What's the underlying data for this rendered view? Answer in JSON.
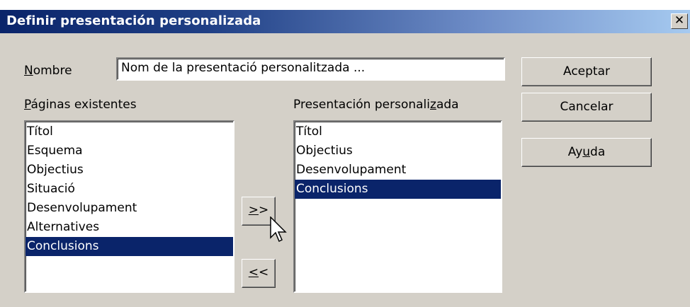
{
  "dialog": {
    "title": "Definir presentación personalizada",
    "close_glyph": "✕"
  },
  "name_field": {
    "label_mnemonic": "N",
    "label_rest": "ombre",
    "value": "Nom de la presentació personalitzada ..."
  },
  "existing_pages": {
    "label_mnemonic": "P",
    "label_rest": "áginas existentes",
    "items": [
      "Títol",
      "Esquema",
      "Objectius",
      "Situació",
      "Desenvolupament",
      "Alternatives",
      "Conclusions"
    ],
    "selected": "Conclusions"
  },
  "custom_presentation": {
    "label_before": "Presentación personali",
    "label_mnemonic": "z",
    "label_after": "ada",
    "items": [
      "Títol",
      "Objectius",
      "Desenvolupament",
      "Conclusions"
    ],
    "selected": "Conclusions"
  },
  "buttons": {
    "add_mnemonic": ">",
    "add_rest": ">",
    "remove_mnemonic": "<",
    "remove_rest": "<",
    "ok": "Aceptar",
    "cancel": "Cancelar",
    "help_before": "Ay",
    "help_mnemonic": "u",
    "help_after": "da"
  },
  "icons": {
    "close": "close-icon",
    "cursor": "mouse-pointer-icon"
  }
}
